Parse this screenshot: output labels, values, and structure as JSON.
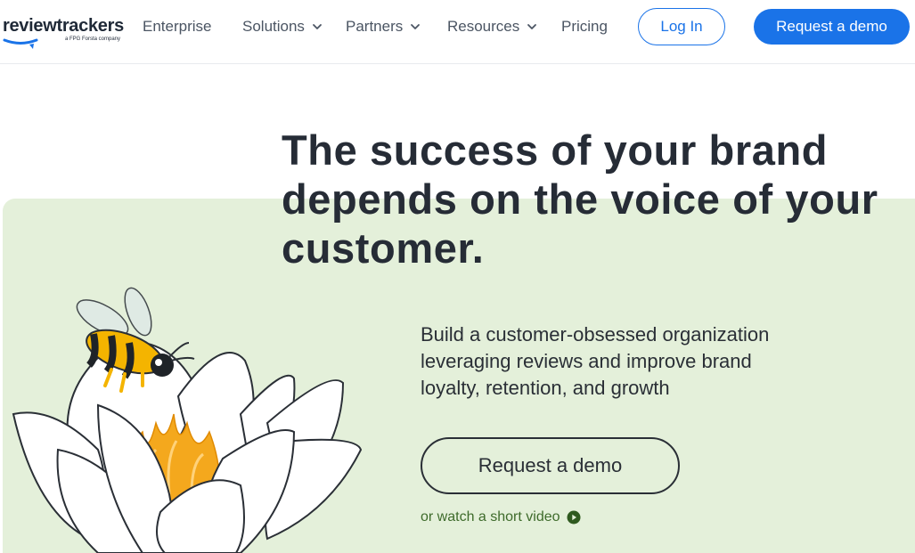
{
  "header": {
    "logo": {
      "wordmark": "reviewtrackers",
      "tagline": "a FPG Forsta company"
    },
    "nav": [
      {
        "label": "Enterprise",
        "dropdown": false
      },
      {
        "label": "Solutions",
        "dropdown": true
      },
      {
        "label": "Partners",
        "dropdown": true
      },
      {
        "label": "Resources",
        "dropdown": true
      },
      {
        "label": "Pricing",
        "dropdown": false
      }
    ],
    "login_label": "Log In",
    "demo_label": "Request a demo"
  },
  "hero": {
    "headline_lines": [
      "The success of your brand",
      "depends on the voice of your",
      "customer."
    ],
    "subtext_lines": [
      "Build a customer-obsessed organization",
      "leveraging reviews and improve brand",
      "loyalty, retention, and growth"
    ],
    "cta_label": "Request a demo",
    "video_link_label": "or watch a short video",
    "illustration": "bee-on-lotus-flower"
  },
  "colors": {
    "brand_blue": "#1a73e8",
    "panel_green": "#e4f0da",
    "link_green": "#3e6b2b",
    "text_dark": "#262c36",
    "bee_yellow": "#f4b400"
  },
  "icons": [
    "chevron-down-icon",
    "play-icon",
    "chat-swoosh-icon"
  ]
}
